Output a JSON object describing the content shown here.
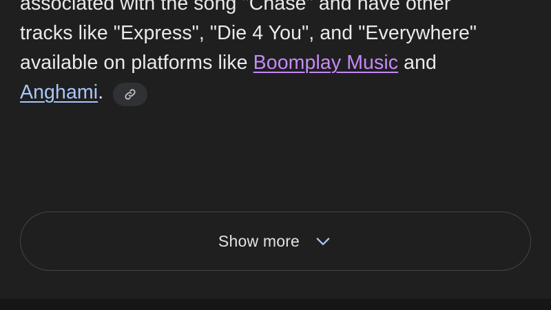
{
  "answer": {
    "line1": "associated with the song \"Chase\" and have other",
    "line2": "tracks like \"Express\", \"Die 4 You\", and \"Everywhere\"",
    "line3_prefix": "available on platforms like ",
    "link1": "Boomplay Music",
    "line3_suffix": " and",
    "link2": "Anghami",
    "line4_suffix": ".",
    "citation_icon": "link-icon"
  },
  "show_more": {
    "label": "Show more",
    "icon": "chevron-down-icon"
  },
  "colors": {
    "background": "#1f1f1f",
    "text": "#e8eaed",
    "visited_link": "#c58af9",
    "link": "#a8c7fa",
    "chip_bg": "#303134",
    "button_border": "#444746"
  }
}
